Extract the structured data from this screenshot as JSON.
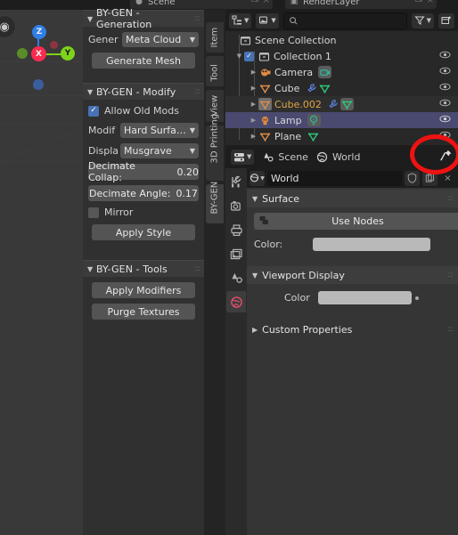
{
  "topbar": {
    "scene_label": "Scene",
    "viewlayer_label": "RenderLayer",
    "scene_icon": "scene-icon",
    "viewlayer_icon": "renderlayer-icon"
  },
  "viewport": {
    "gizmo": {
      "x_label": "X",
      "y_label": "Y",
      "z_label": "Z",
      "x_color": "#fa2b50",
      "y_color": "#7dd31a",
      "z_color": "#2f7fe8"
    },
    "zoom_icon": "zoom-icon"
  },
  "sidebar_tabs": [
    {
      "label": "Item",
      "active": false
    },
    {
      "label": "Tool",
      "active": false
    },
    {
      "label": "View",
      "active": false
    },
    {
      "label": "3D Printing",
      "active": false
    },
    {
      "label": "BY-GEN",
      "active": true
    }
  ],
  "panels": [
    {
      "title": "BY-GEN - Generation",
      "open": true,
      "rows": [
        {
          "kind": "dropdown",
          "label": "Gener",
          "value": "Meta Cloud"
        },
        {
          "kind": "button",
          "label": "Generate Mesh"
        }
      ]
    },
    {
      "title": "BY-GEN - Modify",
      "open": true,
      "rows": [
        {
          "kind": "checkbox",
          "label": "Allow Old Mods",
          "checked": true
        },
        {
          "kind": "dropdown",
          "label": "Modif",
          "value": "Hard Surface F..."
        },
        {
          "kind": "dropdown",
          "label": "Displa",
          "value": "Musgrave"
        },
        {
          "kind": "slider",
          "label": "Decimate Collap:",
          "value": "0.20"
        },
        {
          "kind": "slider",
          "label": "Decimate Angle:",
          "value": "0.17"
        },
        {
          "kind": "checkbox",
          "label": "Mirror",
          "checked": false
        },
        {
          "kind": "button",
          "label": "Apply Style"
        }
      ]
    },
    {
      "title": "BY-GEN - Tools",
      "open": true,
      "rows": [
        {
          "kind": "button",
          "label": "Apply Modifiers"
        },
        {
          "kind": "button",
          "label": "Purge Textures"
        }
      ]
    }
  ],
  "outliner": {
    "header": {
      "display_mode_icon": "outliner-display-mode-icon",
      "filter_id_icon": "id-type-filter-icon",
      "search_icon": "search-icon",
      "search_value": "",
      "search_placeholder": "",
      "filter_icon": "funnel-filter-icon",
      "new_collection_icon": "new-collection-icon"
    },
    "rows": [
      {
        "name": "Scene Collection",
        "indent": 0,
        "icon": "collection-icon",
        "icon_color": "#c9c9c9",
        "disclosure": "",
        "checkbox": false,
        "eye": false,
        "selected": false,
        "amber": false,
        "tags": []
      },
      {
        "name": "Collection 1",
        "indent": 1,
        "icon": "collection-icon",
        "icon_color": "#c9c9c9",
        "disclosure": "down",
        "checkbox": true,
        "eye": true,
        "selected": false,
        "amber": false,
        "tags": []
      },
      {
        "name": "Camera",
        "indent": 2,
        "icon": "camera-icon",
        "icon_color": "#e08a45",
        "disclosure": "right",
        "checkbox": false,
        "eye": true,
        "selected": false,
        "amber": false,
        "tags": [
          {
            "icon": "camera-data-icon",
            "color": "#2fb79b",
            "boxed": true
          }
        ]
      },
      {
        "name": "Cube",
        "indent": 2,
        "icon": "mesh-object-icon",
        "icon_color": "#e08a45",
        "disclosure": "right",
        "checkbox": false,
        "eye": true,
        "selected": false,
        "amber": false,
        "tags": [
          {
            "icon": "modifier-wrench-icon",
            "color": "#5a7fd6",
            "boxed": false
          },
          {
            "icon": "mesh-data-icon",
            "color": "#2fc47a",
            "boxed": false
          }
        ]
      },
      {
        "name": "Cube.002",
        "indent": 2,
        "icon": "mesh-object-icon",
        "icon_color": "#e08a45",
        "disclosure": "right",
        "checkbox": false,
        "eye": true,
        "selected": false,
        "amber": true,
        "tags": [
          {
            "icon": "modifier-wrench-icon",
            "color": "#5a7fd6",
            "boxed": false
          },
          {
            "icon": "mesh-data-icon",
            "color": "#2fc47a",
            "boxed": true
          }
        ]
      },
      {
        "name": "Lamp",
        "indent": 2,
        "icon": "light-object-icon",
        "icon_color": "#e08a45",
        "disclosure": "right",
        "checkbox": false,
        "eye": true,
        "selected": true,
        "amber": false,
        "tags": [
          {
            "icon": "light-data-icon",
            "color": "#2fb79b",
            "boxed": true
          }
        ]
      },
      {
        "name": "Plane",
        "indent": 2,
        "icon": "mesh-object-icon",
        "icon_color": "#e08a45",
        "disclosure": "right",
        "checkbox": false,
        "eye": true,
        "selected": false,
        "amber": false,
        "tags": [
          {
            "icon": "mesh-data-icon",
            "color": "#2fc47a",
            "boxed": false
          }
        ]
      }
    ]
  },
  "properties": {
    "header": {
      "editor_icon": "properties-editor-icon",
      "scene_icon": "scene-icon",
      "scene_label": "Scene",
      "world_icon": "world-icon",
      "world_label": "World",
      "pin_icon": "pin-icon"
    },
    "nav_tabs": [
      {
        "icon": "tool-icon",
        "active": false
      },
      {
        "icon": "render-camera-icon",
        "active": false
      },
      {
        "icon": "output-printer-icon",
        "active": false
      },
      {
        "icon": "view-layer-images-icon",
        "active": false
      },
      {
        "icon": "scene-cone-icon",
        "active": false
      },
      {
        "icon": "world-globe-icon",
        "active": true
      }
    ],
    "id_row": {
      "browse_icon": "browse-world-icon",
      "name_value": "World",
      "fake_user_icon": "shield-fake-user-icon",
      "duplicate_icon": "new-world-icon",
      "unlink_icon": "unlink-x-icon"
    },
    "sections": [
      {
        "title": "Surface",
        "open": true,
        "items": [
          {
            "kind": "use-nodes-button",
            "label": "Use Nodes",
            "icon": "nodes-icon"
          },
          {
            "kind": "color-field",
            "label": "Color:",
            "value": "#b9b9b9"
          }
        ]
      },
      {
        "title": "Viewport Display",
        "open": true,
        "items": [
          {
            "kind": "color-field-right",
            "label": "Color",
            "value": "#b9b9b9"
          }
        ]
      },
      {
        "title": "Custom Properties",
        "open": false,
        "items": []
      }
    ]
  },
  "annotation": {
    "shape": "ellipse",
    "color": "#ef1212",
    "target": "pin-icon"
  }
}
